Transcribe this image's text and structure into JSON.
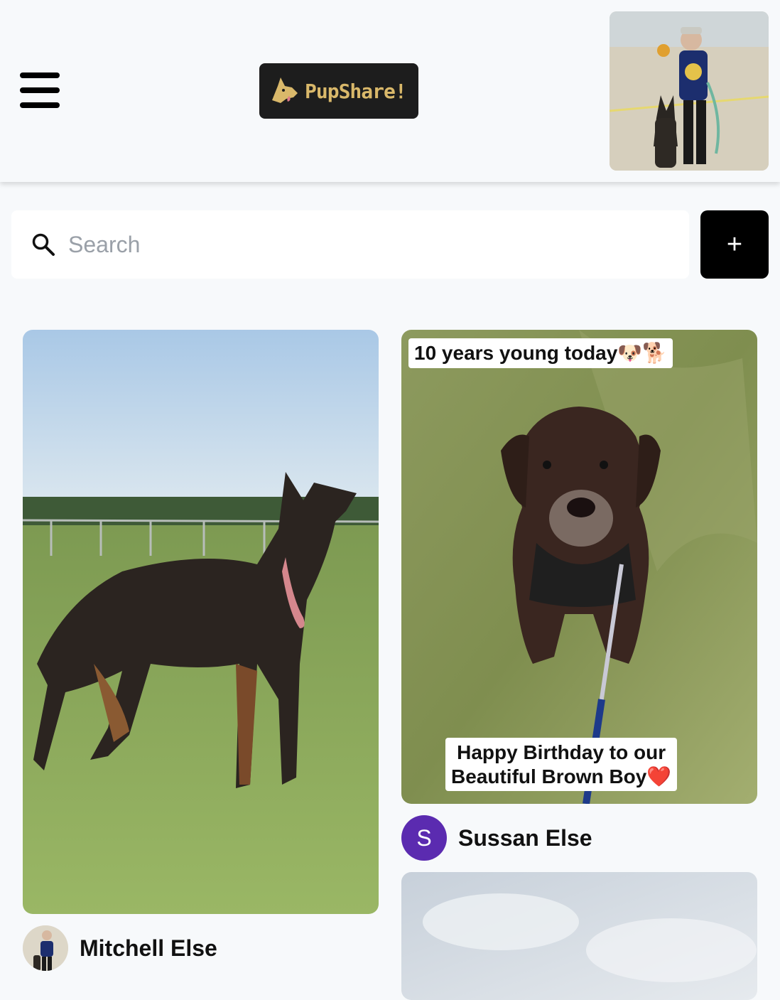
{
  "header": {
    "logo_text": "PupShare!",
    "menu_icon": "hamburger-menu-icon",
    "profile_icon": "user-profile-photo"
  },
  "search": {
    "placeholder": "Search",
    "value": "",
    "icon": "search-icon"
  },
  "add_button": {
    "label": "+"
  },
  "pins": [
    {
      "author": "Mitchell Else",
      "avatar_type": "photo"
    },
    {
      "author": "Sussan Else",
      "avatar_letter": "S",
      "avatar_color": "#5b2bb0",
      "caption_top": "10 years young today🐶🐕",
      "caption_bottom_line1": "Happy Birthday to our",
      "caption_bottom_line2": "Beautiful Brown Boy❤️"
    },
    {
      "author": ""
    }
  ],
  "colors": {
    "background": "#f7f9fb",
    "logo_bg": "#1d1d1d",
    "logo_text": "#d9b86a",
    "add_button_bg": "#000000"
  }
}
